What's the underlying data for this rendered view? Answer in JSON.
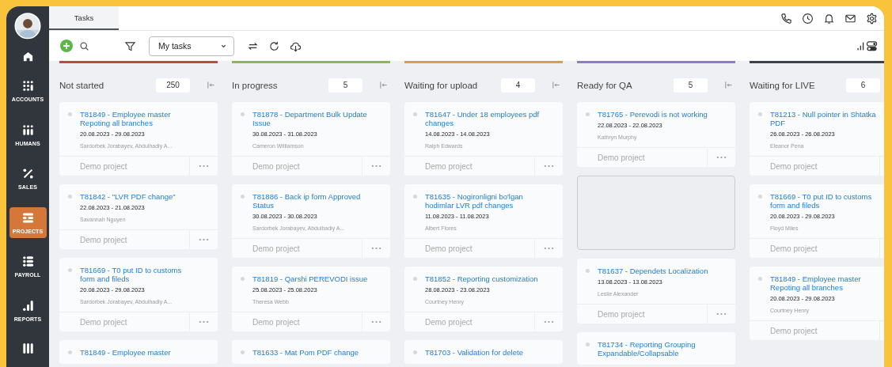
{
  "sidebar": {
    "items": [
      {
        "kind": "home",
        "selected": false
      },
      {
        "kind": "accounts",
        "label": "ACCOUNTS",
        "selected": false
      },
      {
        "kind": "humans",
        "label": "HUMANS",
        "selected": false
      },
      {
        "kind": "sales",
        "label": "SALES",
        "selected": false
      },
      {
        "kind": "projects",
        "label": "PROJECTS",
        "selected": true
      },
      {
        "kind": "payroll",
        "label": "PAYROLL",
        "selected": false
      },
      {
        "kind": "reports",
        "label": "REPORTS",
        "selected": false
      },
      {
        "kind": "documents",
        "selected": false
      }
    ]
  },
  "tabs": [
    {
      "label": "Tasks",
      "selected": true
    }
  ],
  "toolbar": {
    "view_select": {
      "value": "My tasks"
    }
  },
  "columns": [
    {
      "title": "Not started",
      "count": "250",
      "color": "#c0483e",
      "cards": [
        {
          "kind": "task",
          "title": "T81849 - Employee master Repoting all branches",
          "dates": "20.08.2023 - 29.08.2023",
          "assignees": "Sardorbek Jorabayev, Abdulhadiy A...",
          "project": "Demo project"
        },
        {
          "kind": "task",
          "title": "T81842 - \"LVR PDF change\"",
          "dates": "22.08.2023 - 21.08.2023",
          "assignees": "Savannah Nguyen",
          "project": "Demo project"
        },
        {
          "kind": "task",
          "title": "T81669 - T0 put ID to customs form and fileds",
          "dates": "20.08.2023 - 29.08.2023",
          "assignees": "Sardorbek Jorabayev, Abdulhadiy A...",
          "project": "Demo project"
        },
        {
          "kind": "task",
          "title": "T81849 - Employee master"
        }
      ]
    },
    {
      "title": "In progress",
      "count": "5",
      "color": "#8fb55e",
      "cards": [
        {
          "kind": "task",
          "title": "T81878 - Department Bulk Update Issue",
          "dates": "30.08.2023 - 31.08.2023",
          "assignees": "Cameron Williamson",
          "project": "Demo project"
        },
        {
          "kind": "task",
          "title": "T81886 - Back ip form Approved Status",
          "dates": "30.08.2023 - 30.08.2023",
          "assignees": "Sardorbek Jorabayev, Abdulhadiy A...",
          "project": "Demo project"
        },
        {
          "kind": "task",
          "title": "T81819 - Qarshi PEREVODI issue",
          "dates": "25.08.2023 - 25.08.2023",
          "assignees": "Theresa Webb",
          "project": "Demo project"
        },
        {
          "kind": "task",
          "title": "T81633 - Mat Pom PDF change"
        }
      ]
    },
    {
      "title": "Waiting for upload",
      "count": "4",
      "color": "#d4a04a",
      "cards": [
        {
          "kind": "task",
          "title": "T81647 - Under 18 employees pdf changes",
          "dates": "14.08.2023 - 14.08.2023",
          "assignees": "Ralph Edwards",
          "project": "Demo project"
        },
        {
          "kind": "task",
          "title": "T81635 - Nogironligni bo'lgan hodimlar LVR pdf changes",
          "dates": "11.08.2023 - 11.08.2023",
          "assignees": "Albert Flores",
          "project": "Demo project"
        },
        {
          "kind": "task",
          "title": "T81852 - Reporting customization",
          "dates": "28.08.2023 - 23.08.2023",
          "assignees": "Courtney Henry",
          "project": "Demo project"
        },
        {
          "kind": "task",
          "title": "T81703 - Validation for delete"
        }
      ]
    },
    {
      "title": "Ready for QA",
      "count": "5",
      "color": "#8c7cc0",
      "cards": [
        {
          "kind": "task",
          "title": "T81765 - Perevodi is not working",
          "dates": "22.08.2023 - 22.08.2023",
          "assignees": "Kathryn Murphy",
          "project": "Demo project"
        },
        {
          "kind": "placeholder"
        },
        {
          "kind": "task",
          "title": "T81637 - Dependets Localization",
          "dates": "13.08.2023 - 13.08.2023",
          "assignees": "Leslie Alexander",
          "project": "Demo project"
        },
        {
          "kind": "task",
          "title": "T81734 - Reporting Grouping Expandable/Collapsable"
        }
      ]
    },
    {
      "title": "Waiting for LIVE",
      "count": "6",
      "color": "#3d424a",
      "cards": [
        {
          "kind": "task",
          "title": "T81213 - Null pointer in Shtatka PDF",
          "dates": "26.08.2023 - 26.08.2023",
          "assignees": "Eleanor Pena",
          "project": "Demo project"
        },
        {
          "kind": "task",
          "title": "T81669 - T0 put ID to customs form and fileds",
          "dates": "20.08.2023 - 29.08.2023",
          "assignees": "Floyd Miles",
          "project": "Demo project"
        },
        {
          "kind": "task",
          "title": "T81849 - Employee master Repoting all branches",
          "dates": "20.08.2023 - 29.08.2023",
          "assignees": "Courtney Henry",
          "project": "Demo project"
        }
      ]
    }
  ]
}
